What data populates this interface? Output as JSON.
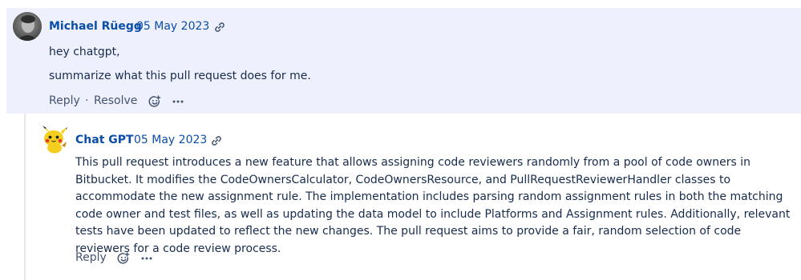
{
  "comment": {
    "author": "Michael Rüegg",
    "date": "05 May 2023",
    "lines": [
      "hey chatgpt,",
      "summarize what this pull request does for me."
    ],
    "actions": {
      "reply": "Reply",
      "separator": "·",
      "resolve": "Resolve"
    }
  },
  "reply": {
    "author": "Chat GPT",
    "date": "05 May 2023",
    "body": "This pull request introduces a new feature that allows assigning code reviewers randomly from a pool of code owners in Bitbucket. It modifies the CodeOwnersCalculator, CodeOwnersResource, and PullRequestReviewerHandler classes to accommodate the new assignment rule. The implementation includes parsing random assignment rules in both the matching code owner and test files, as well as updating the data model to include Platforms and Assignment rules. Additionally, relevant tests have been updated to reflect the new changes. The pull request aims to provide a fair, random selection of code reviewers for a code review process.",
    "actions": {
      "reply": "Reply"
    }
  },
  "colors": {
    "author_link": "#0c4da8",
    "comment_bg": "#eef1fd",
    "text": "#172b4d",
    "action": "#44546f"
  }
}
